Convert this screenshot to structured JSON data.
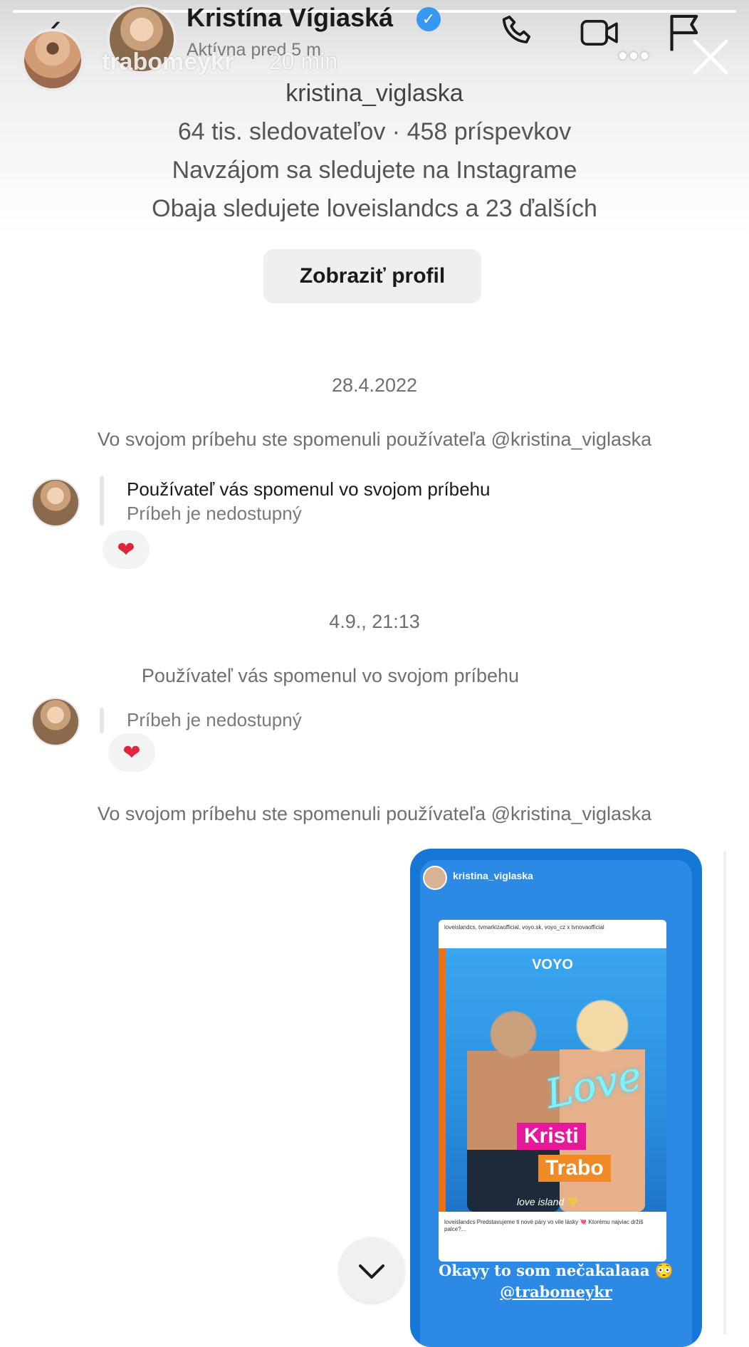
{
  "story": {
    "username": "trabomeykr",
    "time": "20 min",
    "progress": 1.0,
    "more_icon": "more-horizontal-icon",
    "close_icon": "close-icon"
  },
  "dm_header": {
    "back_icon": "chevron-left-icon",
    "name": "Kristína Vígiaská",
    "verified": true,
    "status": "Aktívna pred 5 m",
    "icons": [
      "phone-icon",
      "video-camera-icon",
      "flag-icon"
    ]
  },
  "profile": {
    "username": "kristina_viglaska",
    "stats": "64 tis. sledovateľov · 458 príspevkov",
    "mutual_follow": "Navzájom sa sledujete na Instagrame",
    "mutual_accounts": "Obaja sledujete loveislandcs a 23 ďalších",
    "view_profile_label": "Zobraziť profil"
  },
  "thread": {
    "date1": "28.4.2022",
    "note1": "Vo svojom príbehu ste spomenuli používateľa @kristina_viglaska",
    "msg1_title": "Používateľ vás spomenul vo svojom príbehu",
    "msg1_sub": "Príbeh je nedostupný",
    "reaction": "❤",
    "date2": "4.9., 21:13",
    "note2": "Používateľ vás spomenul vo svojom príbehu",
    "msg2_sub": "Príbeh je nedostupný",
    "note3": "Vo svojom príbehu ste spomenuli používateľa @kristina_viglaska"
  },
  "shared_story": {
    "username": "kristina_viglaska",
    "repost_header": "loveislandcs, tvmarkizaofficial, voyo.sk, voyo_cz x tvnovaofficial",
    "brand": "VOYO",
    "neon_text": "Love",
    "tag1": "Kristi",
    "tag2": "Trabo",
    "logo_text": "love island",
    "repost_caption": "loveislandcs Predstavujeme ti nové páry vo vile lásky 💘 Ktorému najviac držíš palce?...",
    "caption": "Okayy to som nečakalaaa 😳",
    "mention": "@trabomeykr"
  },
  "colors": {
    "accent_blue": "#3897f0",
    "story_card_blue": "#1677d6",
    "heart_red": "#e0263c",
    "tag_pink": "#e6199a",
    "tag_orange": "#f08a26"
  },
  "scroll_down_icon": "chevron-down-icon"
}
